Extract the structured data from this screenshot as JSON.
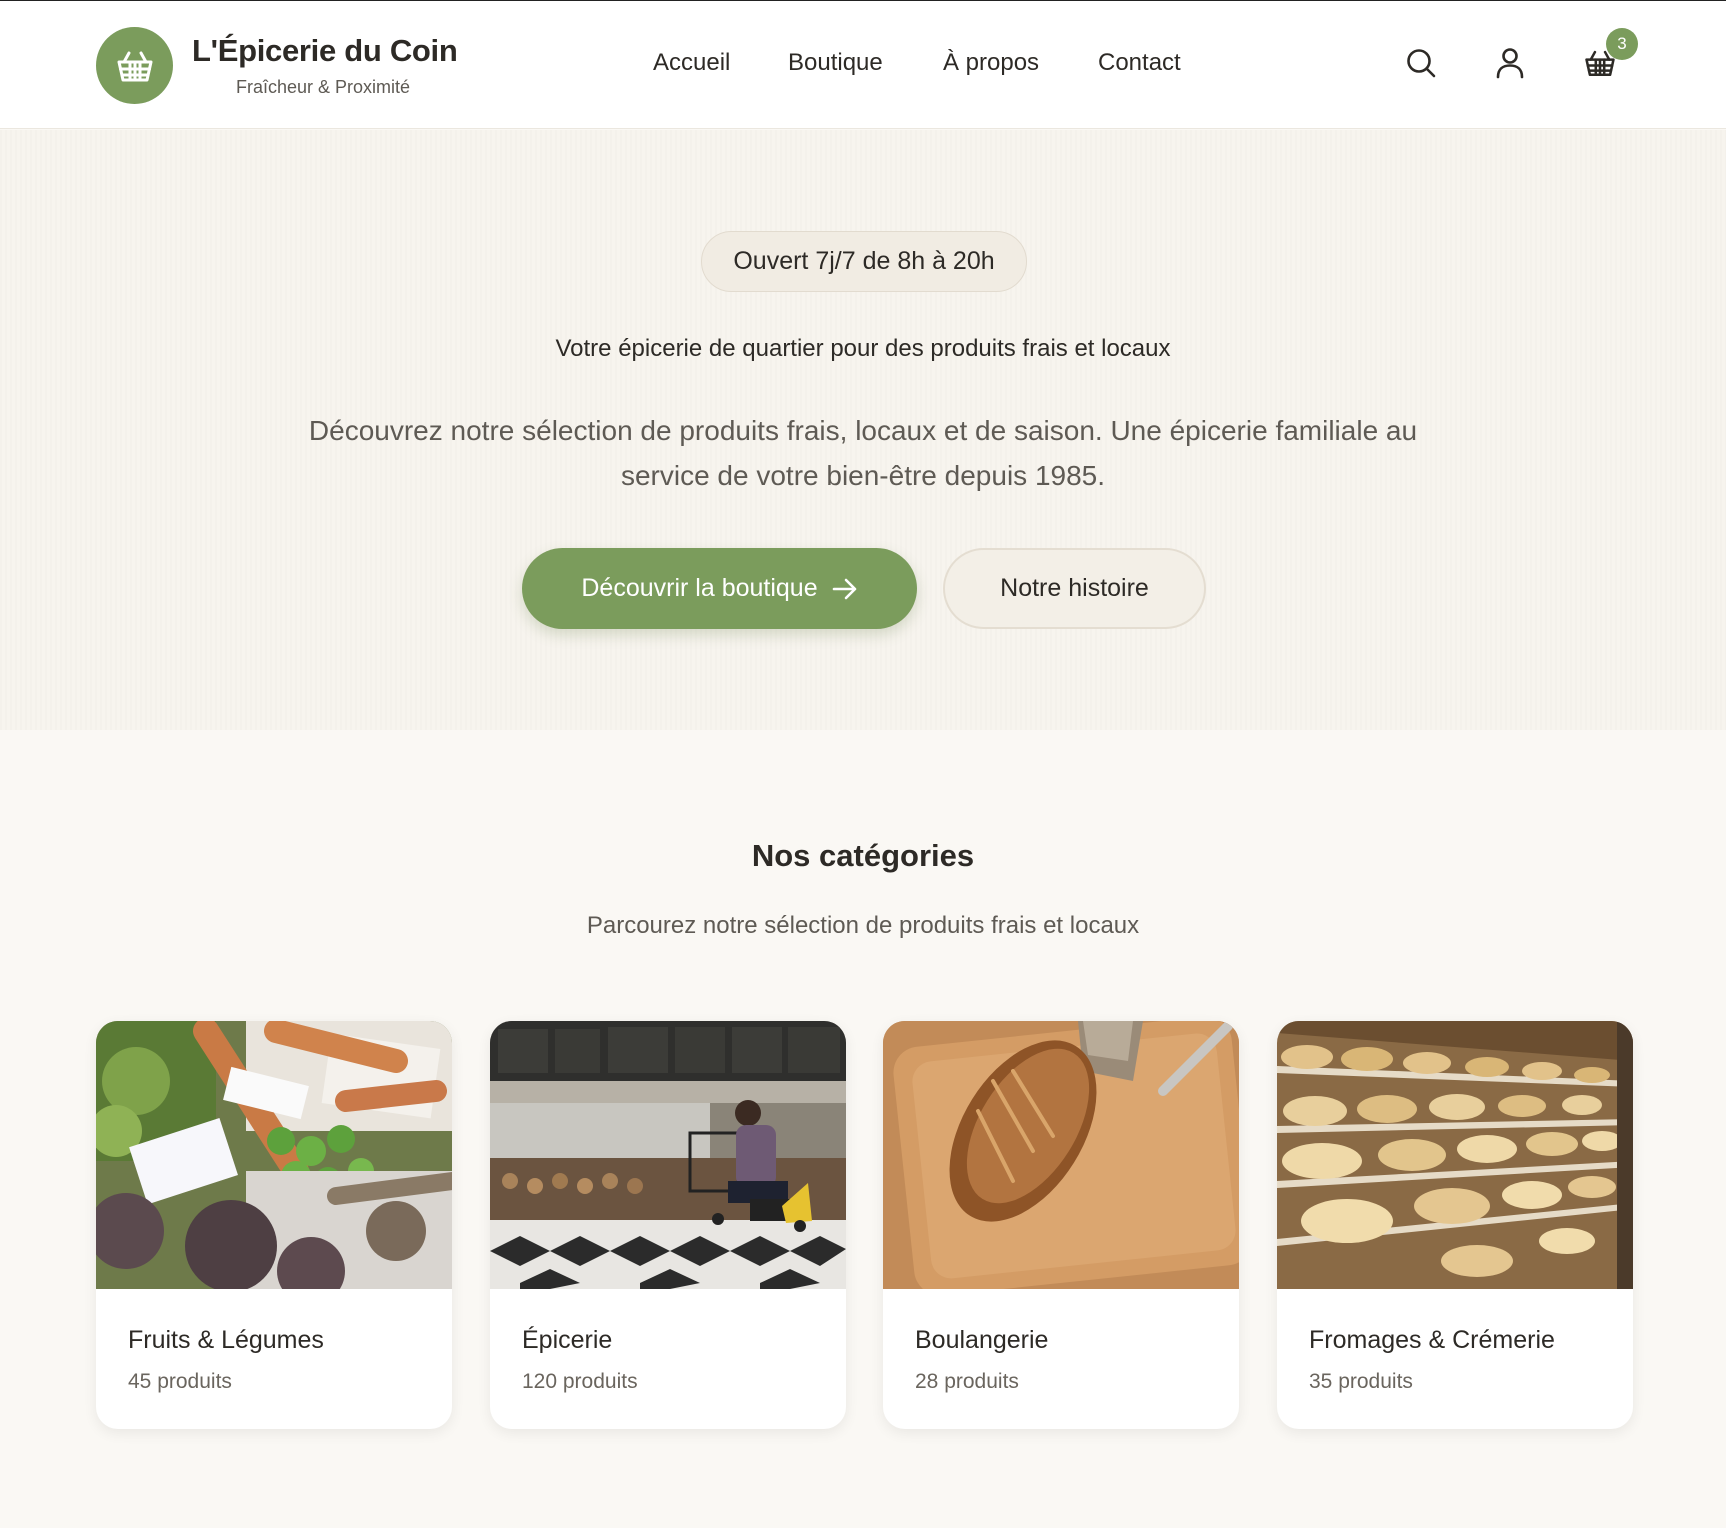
{
  "brand": {
    "name": "L'Épicerie du Coin",
    "tagline": "Fraîcheur & Proximité",
    "logo_icon": "basket-icon",
    "accent_color": "#7b9c5c"
  },
  "nav": {
    "items": [
      {
        "label": "Accueil"
      },
      {
        "label": "Boutique"
      },
      {
        "label": "À propos"
      },
      {
        "label": "Contact"
      }
    ]
  },
  "header_icons": {
    "search": "search-icon",
    "account": "user-icon",
    "cart": "basket-icon",
    "cart_count": "3"
  },
  "hero": {
    "hours_badge": "Ouvert 7j/7 de 8h à 20h",
    "subtitle": "Votre épicerie de quartier pour des produits frais et locaux",
    "description": "Découvrez notre sélection de produits frais, locaux et de saison. Une épicerie familiale au service de votre bien-être depuis 1985.",
    "primary_button": "Découvrir la boutique",
    "secondary_button": "Notre histoire"
  },
  "categories": {
    "title": "Nos catégories",
    "subtitle": "Parcourez notre sélection de produits frais et locaux",
    "items": [
      {
        "name": "Fruits & Légumes",
        "count": "45 produits"
      },
      {
        "name": "Épicerie",
        "count": "120 produits"
      },
      {
        "name": "Boulangerie",
        "count": "28 produits"
      },
      {
        "name": "Fromages & Crémerie",
        "count": "35 produits"
      }
    ]
  }
}
